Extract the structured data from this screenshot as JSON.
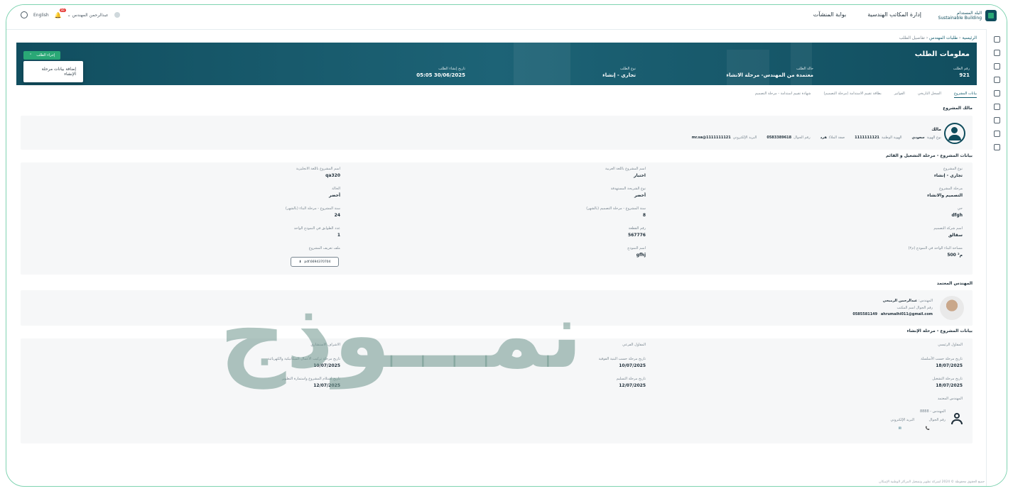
{
  "header": {
    "logo_title": "البلد المستدام",
    "logo_subtitle": "Sustainable Building",
    "nav": [
      "إدارة المكاتب الهندسية",
      "بوابة المنشآت"
    ],
    "language": "English",
    "notification_count": "99",
    "user_name": "عبدالرحمن المهندس"
  },
  "breadcrumb": {
    "home": "الرئيسية",
    "requests": "طلبات المهندس",
    "current": "تفاصيل الطلب"
  },
  "hero": {
    "title": "معلومات الطلب",
    "request_number_label": "رقم الطلب",
    "request_number": "921",
    "status_label": "حالة الطلب",
    "status": "معتمدة من المهندس- مرحلة الانشاء",
    "type_label": "نوع الطلب",
    "type": "تجاري - إنشاء",
    "created_label": "تاريخ إنشاء الطلب",
    "created": "05:05 30/06/2025",
    "actions_button": "إجراء الطلب",
    "menu_item": "إضافة بيانات مرحلة الإنشاء"
  },
  "tabs": [
    "بيانات المشروع",
    "السجل التاريخي",
    "الفواتير",
    "بطاقة تقييم الاستدامة (مرحلة التصميم)",
    "شهادة تقييم استدامة - مرحلة التصميم"
  ],
  "owner": {
    "section_title": "مالك المشروع",
    "name": "مالك",
    "id_type_label": "نوع الهوية",
    "id_type": "سعودي",
    "id_label": "الهوية الوطنية",
    "id": "1111111121",
    "rel_label": "صفة الملاك",
    "rel": "فرد",
    "mobile_label": "رقم الجوال",
    "mobile": "0583389618",
    "email_label": "البريد الإلكتروني",
    "email": "mr.sa@1111111121"
  },
  "project": {
    "section_title": "بيانات المشروع - مرحلة التشغيل و القائم",
    "fields": [
      {
        "label": "نوع المشروع",
        "value": "تجاري - إنشاء"
      },
      {
        "label": "اسم المشروع باللغة العربية",
        "value": "اختبار"
      },
      {
        "label": "اسم المشروع باللغة الانجليزية",
        "value": "qa320"
      },
      {
        "label": "مرحلة المشروع",
        "value": "التصميم والانشاء"
      },
      {
        "label": "نوع الشريحة المستهدفة",
        "value": "أخضر"
      },
      {
        "label": "الحالة",
        "value": "أخضر"
      },
      {
        "label": "حي",
        "value": "dfgh"
      },
      {
        "label": "سنة المشروع - مرحلة التصميم (بالشهر)",
        "value": "8"
      },
      {
        "label": "سنة المشروع - مرحلة البناء (بالشهر)",
        "value": "24"
      },
      {
        "label": "اسم شركة التصميم",
        "value": "سقالق"
      },
      {
        "label": "رقم القطعة",
        "value": "567776"
      },
      {
        "label": "عدد الطوابق في النموذج الواحد",
        "value": "1"
      },
      {
        "label": "مساحة البناء الواحد في النموذج (م٢)",
        "value": "500 م²"
      },
      {
        "label": "اسم النموذج",
        "value": "gfhj"
      },
      {
        "label": "ملف تعريف المشروع",
        "value": "pdf.6694370704"
      }
    ]
  },
  "engineer": {
    "section_title": "المهندس المعتمد",
    "name_label": "المهندس",
    "name": "عبدالرحمن الرميحي",
    "mobile_label": "رقم الجوال",
    "mobile": "0585581149",
    "email_label": "البريد الإلكتروني",
    "email": "ahrumaihi011@gmail.com",
    "office_label": "اسم المكتب",
    "office": "اسم المكتب"
  },
  "construction": {
    "section_title": "بيانات المشروع - مرحلة الإنشاء",
    "fields": [
      {
        "label": "المقاول الرئيسي",
        "value": ""
      },
      {
        "label": "المقاول الفرعي",
        "value": ""
      },
      {
        "label": "الاشراف الاستشاري",
        "value": ""
      },
      {
        "label": "تاريخ مرحلة حسب الأسلسلة",
        "value": "18/07/2025"
      },
      {
        "label": "تاريخ مرحلة حسب البنية الفوقية",
        "value": "10/07/2025"
      },
      {
        "label": "تاريخ مرحلة تركيب الأعمال الميكانيكية والكهربائية",
        "value": "10/07/2025"
      },
      {
        "label": "تاريخ مرحلة التشغيل",
        "value": "18/07/2025"
      },
      {
        "label": "تاريخ مرحلة التسليم",
        "value": "12/07/2025"
      },
      {
        "label": "تاريخ استلام المشروع واستمارة التطوير",
        "value": "12/07/2025"
      }
    ],
    "supervisor_label": "المهندس المعتمد",
    "sub_label": "المهندس - 8888",
    "mobile_label": "رقم الجوال",
    "email_label": "البريد الإلكتروني"
  },
  "watermark": "نمـــوذج",
  "footer": "جميع الحقوق محفوظة © 2024 لشركة تطوير وتشغيل المراكز الوطنية الإسكان"
}
